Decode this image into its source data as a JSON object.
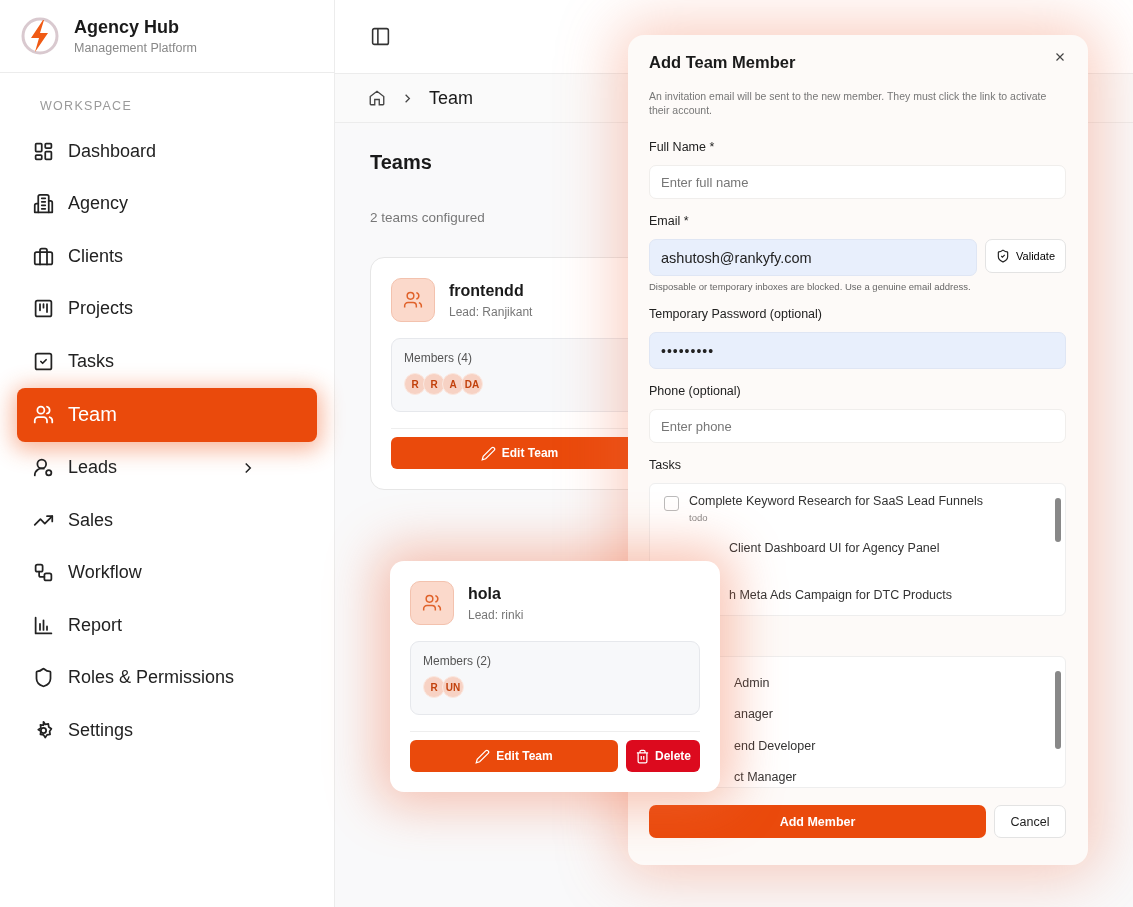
{
  "brand": {
    "name": "Agency Hub",
    "subtitle": "Management Platform"
  },
  "sidebar": {
    "section": "WORKSPACE",
    "items": [
      {
        "label": "Dashboard",
        "selected": false,
        "expandable": false
      },
      {
        "label": "Agency",
        "selected": false,
        "expandable": false
      },
      {
        "label": "Clients",
        "selected": false,
        "expandable": false
      },
      {
        "label": "Projects",
        "selected": false,
        "expandable": false
      },
      {
        "label": "Tasks",
        "selected": false,
        "expandable": false
      },
      {
        "label": "Team",
        "selected": true,
        "expandable": false
      },
      {
        "label": "Leads",
        "selected": false,
        "expandable": true
      },
      {
        "label": "Sales",
        "selected": false,
        "expandable": false
      },
      {
        "label": "Workflow",
        "selected": false,
        "expandable": false
      },
      {
        "label": "Report",
        "selected": false,
        "expandable": false
      },
      {
        "label": "Roles & Permissions",
        "selected": false,
        "expandable": false
      },
      {
        "label": "Settings",
        "selected": false,
        "expandable": false
      }
    ]
  },
  "breadcrumb": {
    "current": "Team"
  },
  "page": {
    "title": "Teams",
    "subtitle": "2 teams configured"
  },
  "teams": [
    {
      "name": "frontendd",
      "lead": "Lead: Ranjikant",
      "members_label": "Members (4)",
      "members": [
        "R",
        "R",
        "A",
        "DA"
      ],
      "edit_label": "Edit Team"
    },
    {
      "name": "hola",
      "lead": "Lead: rinki",
      "members_label": "Members (2)",
      "members": [
        "R",
        "UN"
      ],
      "edit_label": "Edit Team",
      "delete_label": "Delete"
    }
  ],
  "modal": {
    "title": "Add Team Member",
    "description": "An invitation email will be sent to the new member. They must click the link to activate their account.",
    "full_name": {
      "label": "Full Name *",
      "placeholder": "Enter full name"
    },
    "email": {
      "label": "Email *",
      "value": "ashutosh@rankyfy.com",
      "validate_label": "Validate",
      "hint": "Disposable or temporary inboxes are blocked. Use a genuine email address."
    },
    "password": {
      "label": "Temporary Password (optional)",
      "value": "•••••••••"
    },
    "phone": {
      "label": "Phone (optional)",
      "placeholder": "Enter phone"
    },
    "tasks": {
      "label": "Tasks",
      "items": [
        {
          "title": "Complete Keyword Research for SaaS Lead Funnels",
          "status": "todo",
          "checked": false
        },
        {
          "title": "Client Dashboard UI for Agency Panel"
        },
        {
          "title": "h Meta Ads Campaign for DTC Products"
        }
      ]
    },
    "roles": {
      "items": [
        {
          "title": "Admin"
        },
        {
          "title": "anager"
        },
        {
          "title": "end Developer"
        },
        {
          "title": "ct Manager"
        }
      ]
    },
    "submit_label": "Add Member",
    "cancel_label": "Cancel"
  }
}
